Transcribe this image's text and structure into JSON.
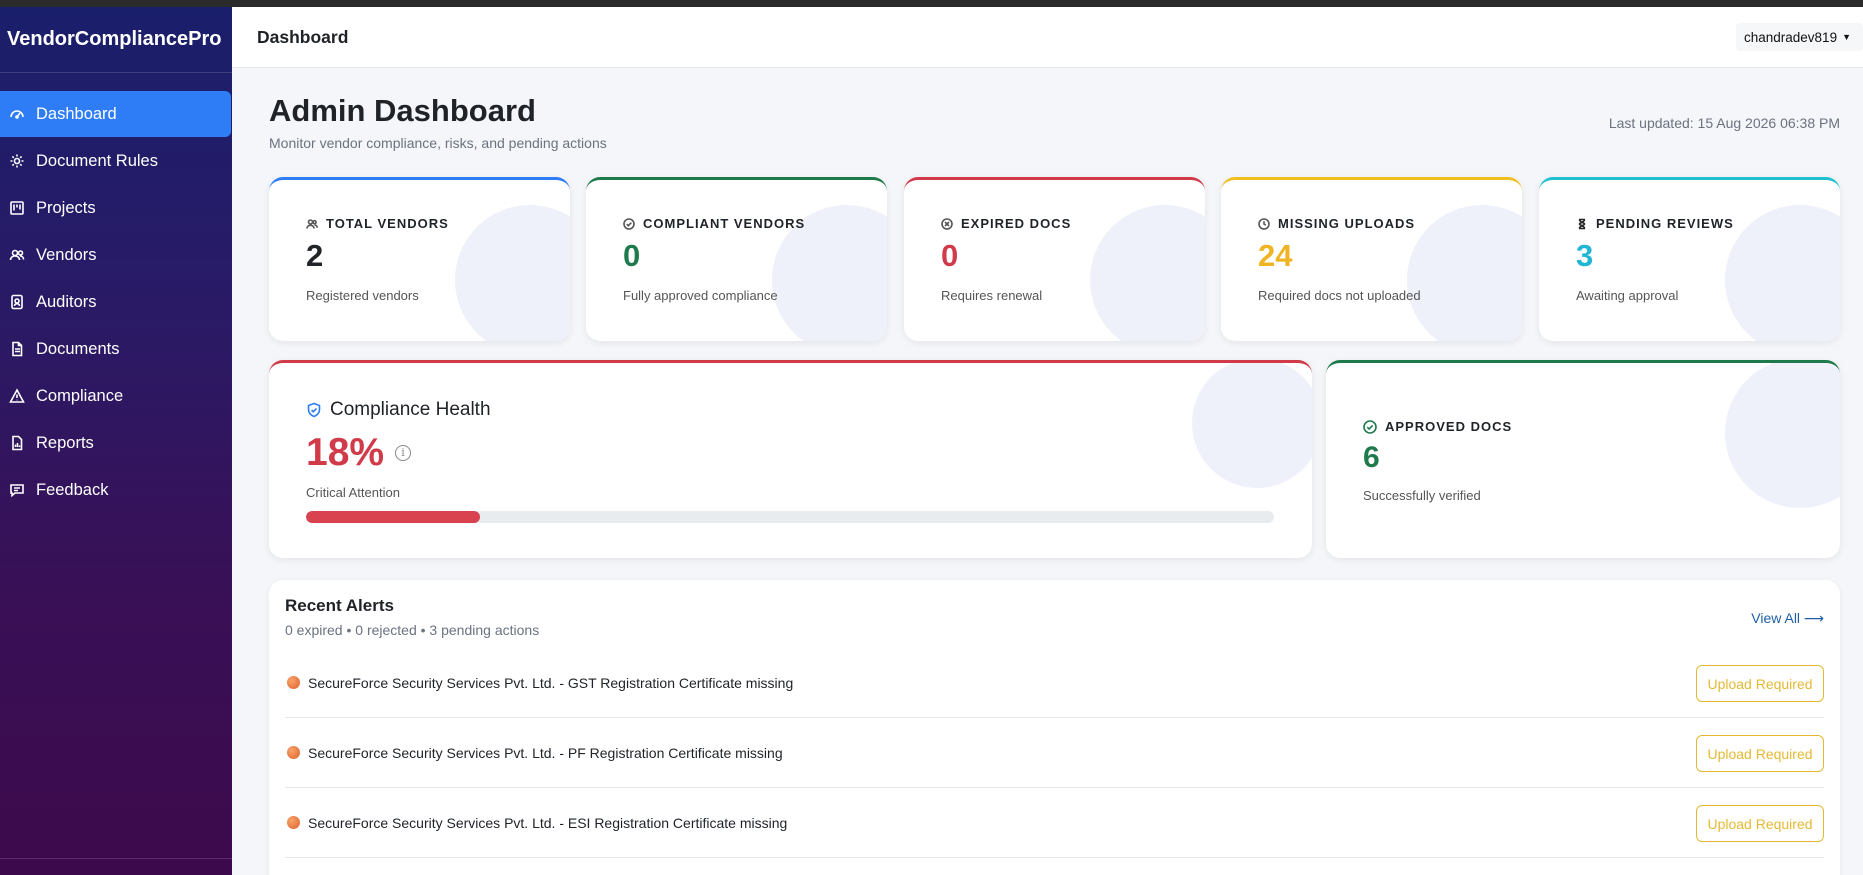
{
  "app": {
    "brand": "VendorCompliancePro"
  },
  "sidebar": {
    "items": [
      {
        "label": "Dashboard",
        "icon": "gauge-icon",
        "active": true
      },
      {
        "label": "Document Rules",
        "icon": "gear-icon"
      },
      {
        "label": "Projects",
        "icon": "kanban-icon"
      },
      {
        "label": "Vendors",
        "icon": "people-icon"
      },
      {
        "label": "Auditors",
        "icon": "id-badge-icon"
      },
      {
        "label": "Documents",
        "icon": "file-icon"
      },
      {
        "label": "Compliance",
        "icon": "warning-triangle-icon"
      },
      {
        "label": "Reports",
        "icon": "report-file-icon"
      },
      {
        "label": "Feedback",
        "icon": "chat-icon"
      }
    ]
  },
  "topbar": {
    "title": "Dashboard",
    "user": "chandradev819"
  },
  "header": {
    "title": "Admin Dashboard",
    "subtitle": "Monitor vendor compliance, risks, and pending actions",
    "last_updated": "Last updated: 15 Aug 2026 06:38 PM"
  },
  "stats": [
    {
      "label": "TOTAL VENDORS",
      "value": "2",
      "desc": "Registered vendors",
      "color": "#212529",
      "accent": "#2f7df6",
      "icon": "people-icon"
    },
    {
      "label": "COMPLIANT VENDORS",
      "value": "0",
      "desc": "Fully approved compliance",
      "color": "#1e7a4b",
      "accent": "#1e7a4b",
      "icon": "check-circle-icon"
    },
    {
      "label": "EXPIRED DOCS",
      "value": "0",
      "desc": "Requires renewal",
      "color": "#d13a48",
      "accent": "#d13a48",
      "icon": "x-circle-icon"
    },
    {
      "label": "MISSING UPLOADS",
      "value": "24",
      "desc": "Required docs not uploaded",
      "color": "#f0b323",
      "accent": "#f0c020",
      "icon": "clock-icon"
    },
    {
      "label": "PENDING REVIEWS",
      "value": "3",
      "desc": "Awaiting approval",
      "color": "#1fb6d4",
      "accent": "#1fc0d0",
      "icon": "hourglass-icon"
    }
  ],
  "health": {
    "title": "Compliance Health",
    "value": "18%",
    "percent": 18,
    "status": "Critical Attention",
    "color": "#d13a48"
  },
  "approved": {
    "label": "APPROVED DOCS",
    "value": "6",
    "desc": "Successfully verified",
    "color": "#1e7a4b"
  },
  "alerts": {
    "title": "Recent Alerts",
    "summary": "0 expired • 0 rejected • 3 pending actions",
    "view_all": "View All ⟶",
    "items": [
      {
        "text": "SecureForce Security Services Pvt. Ltd. - GST Registration Certificate missing",
        "action": "Upload Required"
      },
      {
        "text": "SecureForce Security Services Pvt. Ltd. - PF Registration Certificate missing",
        "action": "Upload Required"
      },
      {
        "text": "SecureForce Security Services Pvt. Ltd. - ESI Registration Certificate missing",
        "action": "Upload Required"
      }
    ]
  }
}
